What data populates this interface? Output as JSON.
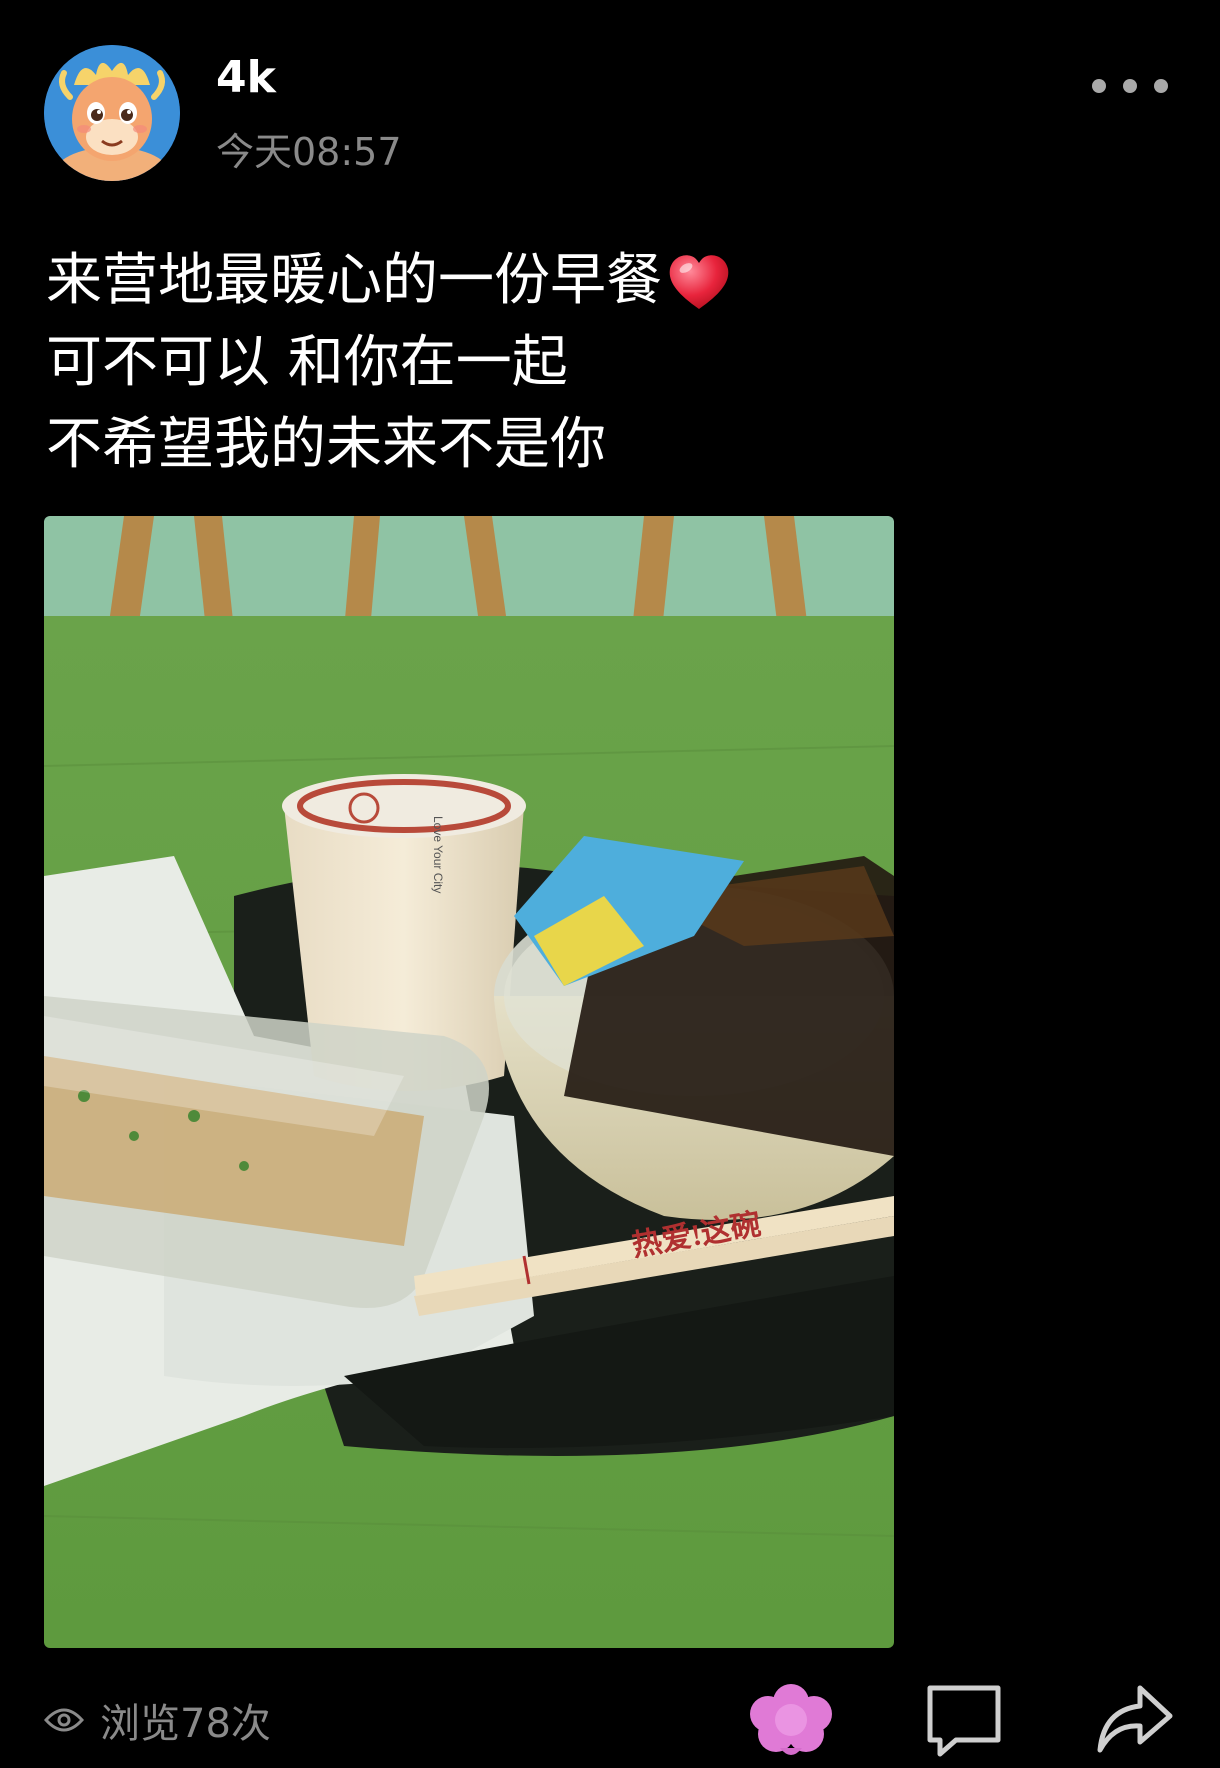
{
  "post": {
    "username": "4k",
    "timestamp": "今天08:57",
    "lines": [
      "来营地最暖心的一份早餐",
      "可不可以 和你在一起",
      "不希望我的未来不是你"
    ],
    "emoji_after_first_line": "heart-icon",
    "photo_texts": {
      "cup_side": "Love Your City",
      "chopsticks": "热爱!这碗"
    }
  },
  "footer": {
    "views_label": "浏览78次",
    "icons": [
      "eye-icon",
      "flower-icon",
      "comment-icon",
      "share-icon"
    ]
  },
  "colors": {
    "background": "#000000",
    "text": "#ffffff",
    "muted": "#8a8a8a",
    "flower": "#e07ad6"
  }
}
